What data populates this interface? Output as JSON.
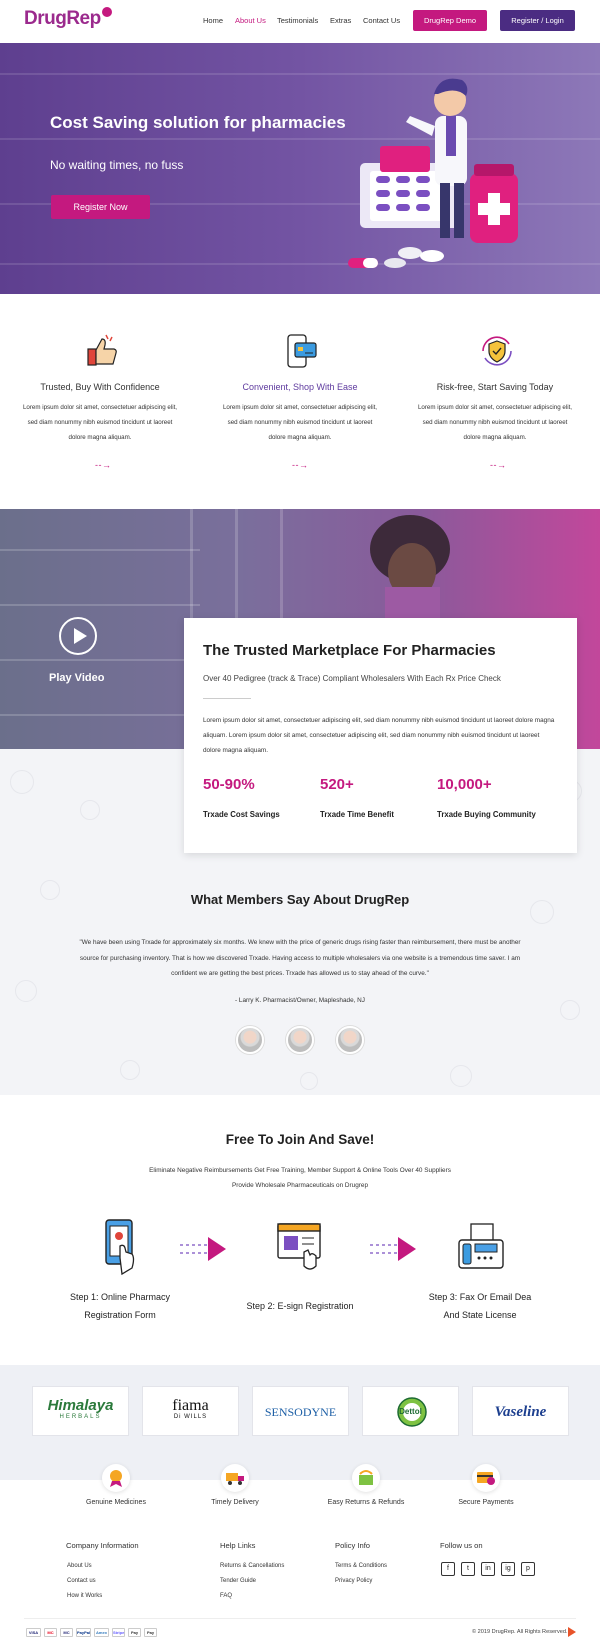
{
  "brand": {
    "logo_text": "DrugRep",
    "accent": "#c4197f",
    "purple": "#4b2c82"
  },
  "nav": {
    "items": [
      "Home",
      "About Us",
      "Testimonials",
      "Extras",
      "Contact Us"
    ],
    "active": "About Us",
    "demo_button": "DrugRep Demo",
    "login_button": "Register / Login"
  },
  "hero": {
    "title": "Cost Saving solution for pharmacies",
    "subtitle": "No waiting times, no fuss",
    "cta": "Register Now"
  },
  "features": [
    {
      "icon": "thumbs-up-icon",
      "title": "Trusted, Buy With Confidence",
      "text": "Lorem ipsum dolor sit amet, consectetuer adipiscing elit, sed diam nonummy nibh euismod tincidunt ut laoreet dolore magna aliquam.",
      "arrow": "- - →"
    },
    {
      "icon": "phone-card-icon",
      "title": "Convenient, Shop With Ease",
      "text": "Lorem ipsum dolor sit amet, consectetuer adipiscing elit, sed diam nonummy nibh euismod tincidunt ut laoreet dolore magna aliquam.",
      "arrow": "- - →"
    },
    {
      "icon": "shield-check-icon",
      "title": "Risk-free, Start Saving Today",
      "text": "Lorem ipsum dolor sit amet, consectetuer adipiscing elit, sed diam nonummy nibh euismod tincidunt ut laoreet dolore magna aliquam.",
      "arrow": "- - →"
    }
  ],
  "video": {
    "label": "Play Video"
  },
  "marketplace": {
    "title": "The Trusted Marketplace For Pharmacies",
    "subtitle": "Over 40 Pedigree (track & Trace) Compliant Wholesalers With Each Rx Price Check",
    "text": "Lorem ipsum dolor sit amet, consectetuer adipiscing elit, sed diam nonummy nibh euismod tincidunt ut laoreet dolore magna aliquam. Lorem ipsum dolor sit amet, consectetuer adipiscing elit, sed diam nonummy nibh euismod tincidunt ut laoreet dolore magna aliquam.",
    "stats": [
      {
        "value": "50-90%",
        "label": "Trxade Cost Savings"
      },
      {
        "value": "520+",
        "label": "Trxade Time Benefit"
      },
      {
        "value": "10,000+",
        "label": "Trxade Buying Community"
      }
    ]
  },
  "testimonials": {
    "title": "What Members Say About DrugRep",
    "quote": "\"We have been using Trxade for approximately six months. We knew with the price of generic drugs rising faster than reimbursement, there must be another source for purchasing inventory. That is how we discovered Trxade. Having access to multiple wholesalers via one website is a tremendous time saver. I am confident we are getting the best prices. Trxade has allowed us to stay ahead of the curve.\"",
    "author": "- Larry K.  Pharmacist/Owner, Mapleshade, NJ"
  },
  "join": {
    "title": "Free To Join And Save!",
    "subtitle_line1": "Eliminate Negative Reimbursements Get Free Training, Member Support & Online Tools Over 40 Suppliers",
    "subtitle_line2": "Provide Wholesale Pharmaceuticals on Drugrep",
    "steps": [
      {
        "icon": "mobile-form-icon",
        "line1": "Step 1: Online Pharmacy",
        "line2": "Registration Form"
      },
      {
        "icon": "e-sign-icon",
        "line1": "Step 2: E-sign Registration",
        "line2": ""
      },
      {
        "icon": "fax-machine-icon",
        "line1": "Step 3: Fax Or Email Dea",
        "line2": "And State License"
      }
    ]
  },
  "brands": [
    {
      "name": "Himalaya",
      "sub": "HERBALS",
      "color": "#2b7a3b"
    },
    {
      "name": "fiama",
      "sub": "Di WILLS",
      "color": "#111111"
    },
    {
      "name": "SENSODYNE",
      "sub": "",
      "color": "#1d5fa6"
    },
    {
      "name": "Dettol",
      "sub": "",
      "color": "#1d6b32"
    },
    {
      "name": "Vaseline",
      "sub": "",
      "color": "#1d3f8f"
    }
  ],
  "benefits": [
    {
      "icon": "medal-icon",
      "label": "Genuine Medicines"
    },
    {
      "icon": "truck-icon",
      "label": "Timely Delivery"
    },
    {
      "icon": "return-icon",
      "label": "Easy Returns & Refunds"
    },
    {
      "icon": "secure-card-icon",
      "label": "Secure Payments"
    }
  ],
  "footer": {
    "company": {
      "heading": "Company Information",
      "links": [
        "About Us",
        "Contact us",
        "How it Works"
      ]
    },
    "help": {
      "heading": "Help Links",
      "links": [
        "Returns & Cancellations",
        "Tender Guide",
        "FAQ"
      ]
    },
    "policy": {
      "heading": "Policy Info",
      "links": [
        "Terms & Conditions",
        "Privacy Policy"
      ]
    },
    "follow": {
      "heading": "Follow us on",
      "icons": [
        "f",
        "t",
        "in",
        "ig",
        "p"
      ]
    },
    "payments": [
      "VISA",
      "MC",
      "MC",
      "PayPal",
      "Amex",
      "Stripe",
      "Pay",
      "Pay"
    ],
    "copyright": "© 2019 DrugRep. All Rights Reserved."
  }
}
